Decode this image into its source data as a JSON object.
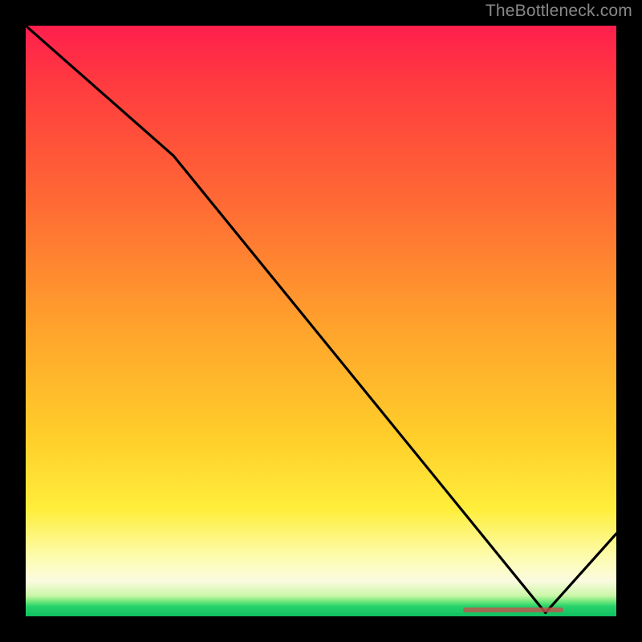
{
  "watermark": "TheBottleneck.com",
  "colors": {
    "background": "#000000",
    "curve": "#000000",
    "marker": "#c0564d"
  },
  "chart_data": {
    "type": "line",
    "title": "",
    "xlabel": "",
    "ylabel": "",
    "xlim": [
      0,
      100
    ],
    "ylim": [
      0,
      100
    ],
    "series": [
      {
        "name": "curve",
        "x": [
          0,
          25,
          88,
          100
        ],
        "y": [
          100,
          78,
          0.6,
          14
        ]
      }
    ],
    "marker_segment": {
      "x_start": 74,
      "x_end": 91,
      "y": 0.6
    },
    "gradient_stops": [
      {
        "pct": 0,
        "color": "#ff1f4d"
      },
      {
        "pct": 50,
        "color": "#ffa02c"
      },
      {
        "pct": 82,
        "color": "#ffee3c"
      },
      {
        "pct": 94,
        "color": "#fbfbe0"
      },
      {
        "pct": 100,
        "color": "#0fbf62"
      }
    ]
  }
}
